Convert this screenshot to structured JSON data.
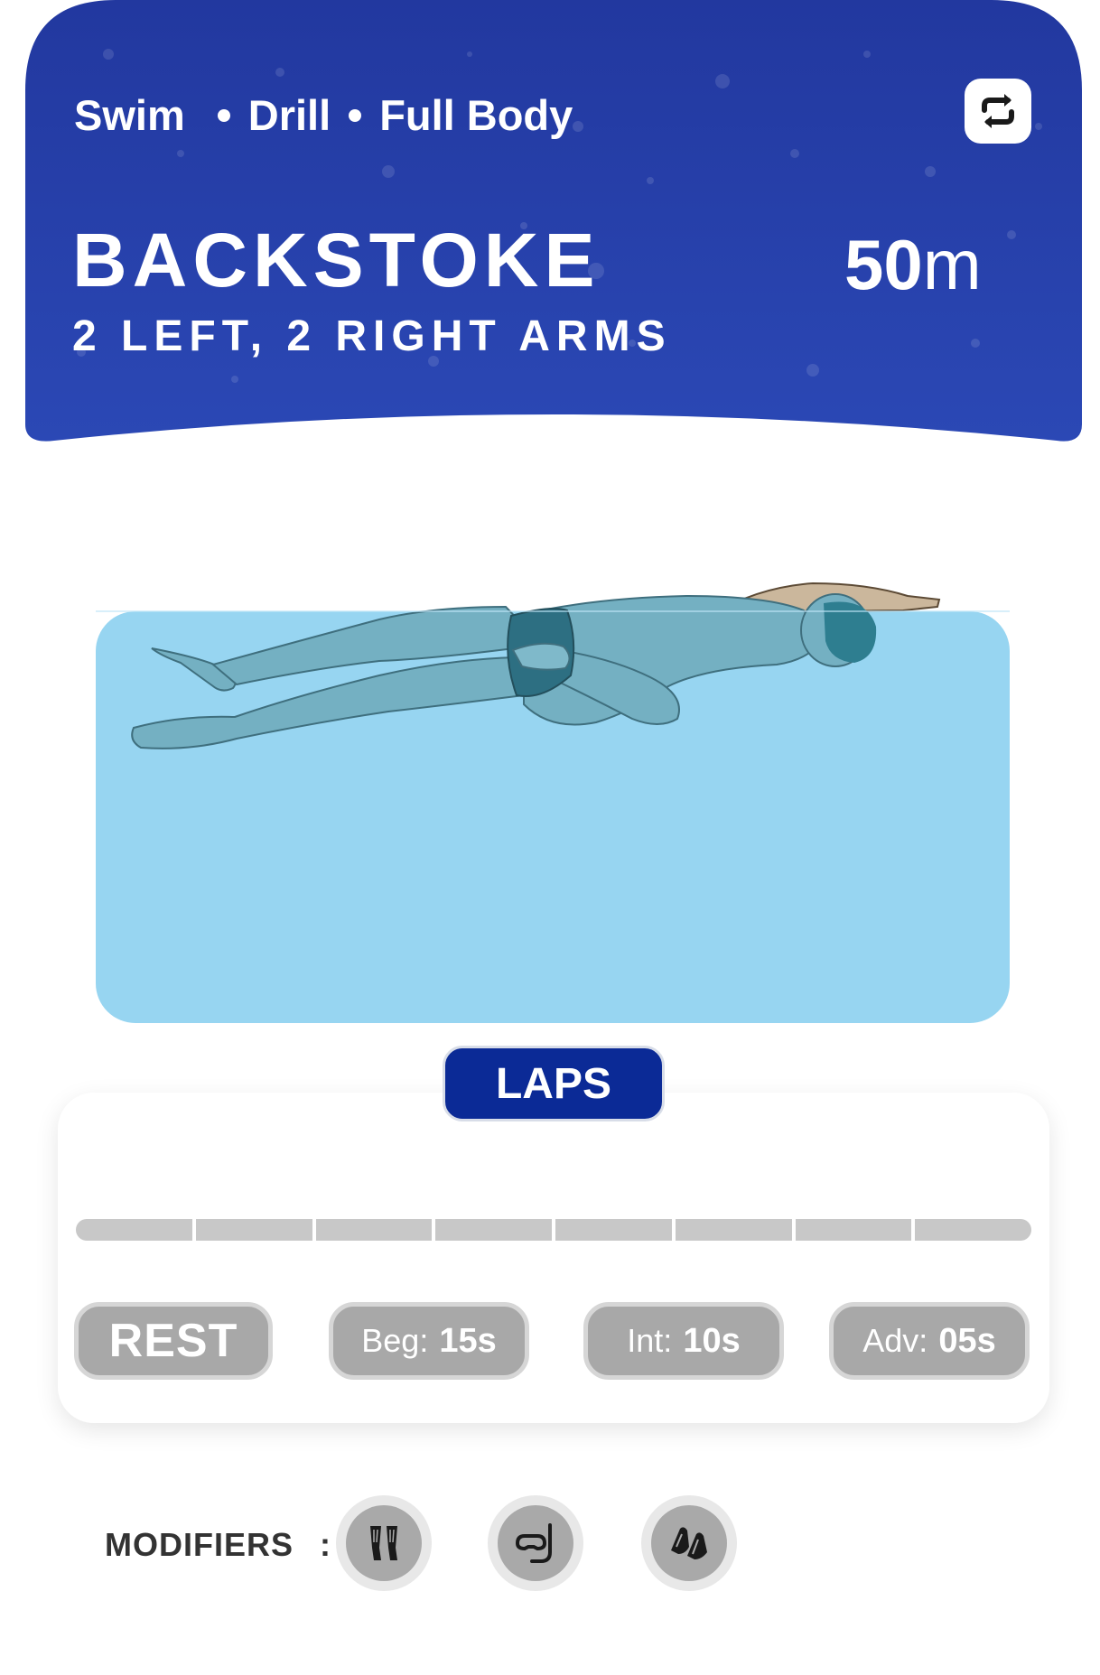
{
  "header": {
    "breadcrumb": [
      "Swim",
      "Drill",
      "Full Body"
    ],
    "title": "BACKSTOKE",
    "subtitle": "2 LEFT, 2 RIGHT ARMS",
    "distance_value": "50",
    "distance_unit": "m",
    "sync_icon": "repeat-icon",
    "colors": {
      "primary": "#1f3ea8",
      "primary_dark": "#0b2a96"
    }
  },
  "illustration": {
    "subject": "swimmer-backstroke",
    "pool_color": "#97d5f1"
  },
  "laps": {
    "label": "LAPS",
    "total_segments": 8,
    "completed_segments": 0
  },
  "rest": {
    "label": "REST",
    "levels": [
      {
        "label": "Beg:",
        "value": "15s"
      },
      {
        "label": "Int:",
        "value": "10s"
      },
      {
        "label": "Adv:",
        "value": "05s"
      }
    ]
  },
  "modifiers": {
    "label": "MODIFIERS",
    "separator": ":",
    "items": [
      {
        "icon": "fins-icon"
      },
      {
        "icon": "snorkel-icon"
      },
      {
        "icon": "paddles-icon"
      }
    ]
  }
}
